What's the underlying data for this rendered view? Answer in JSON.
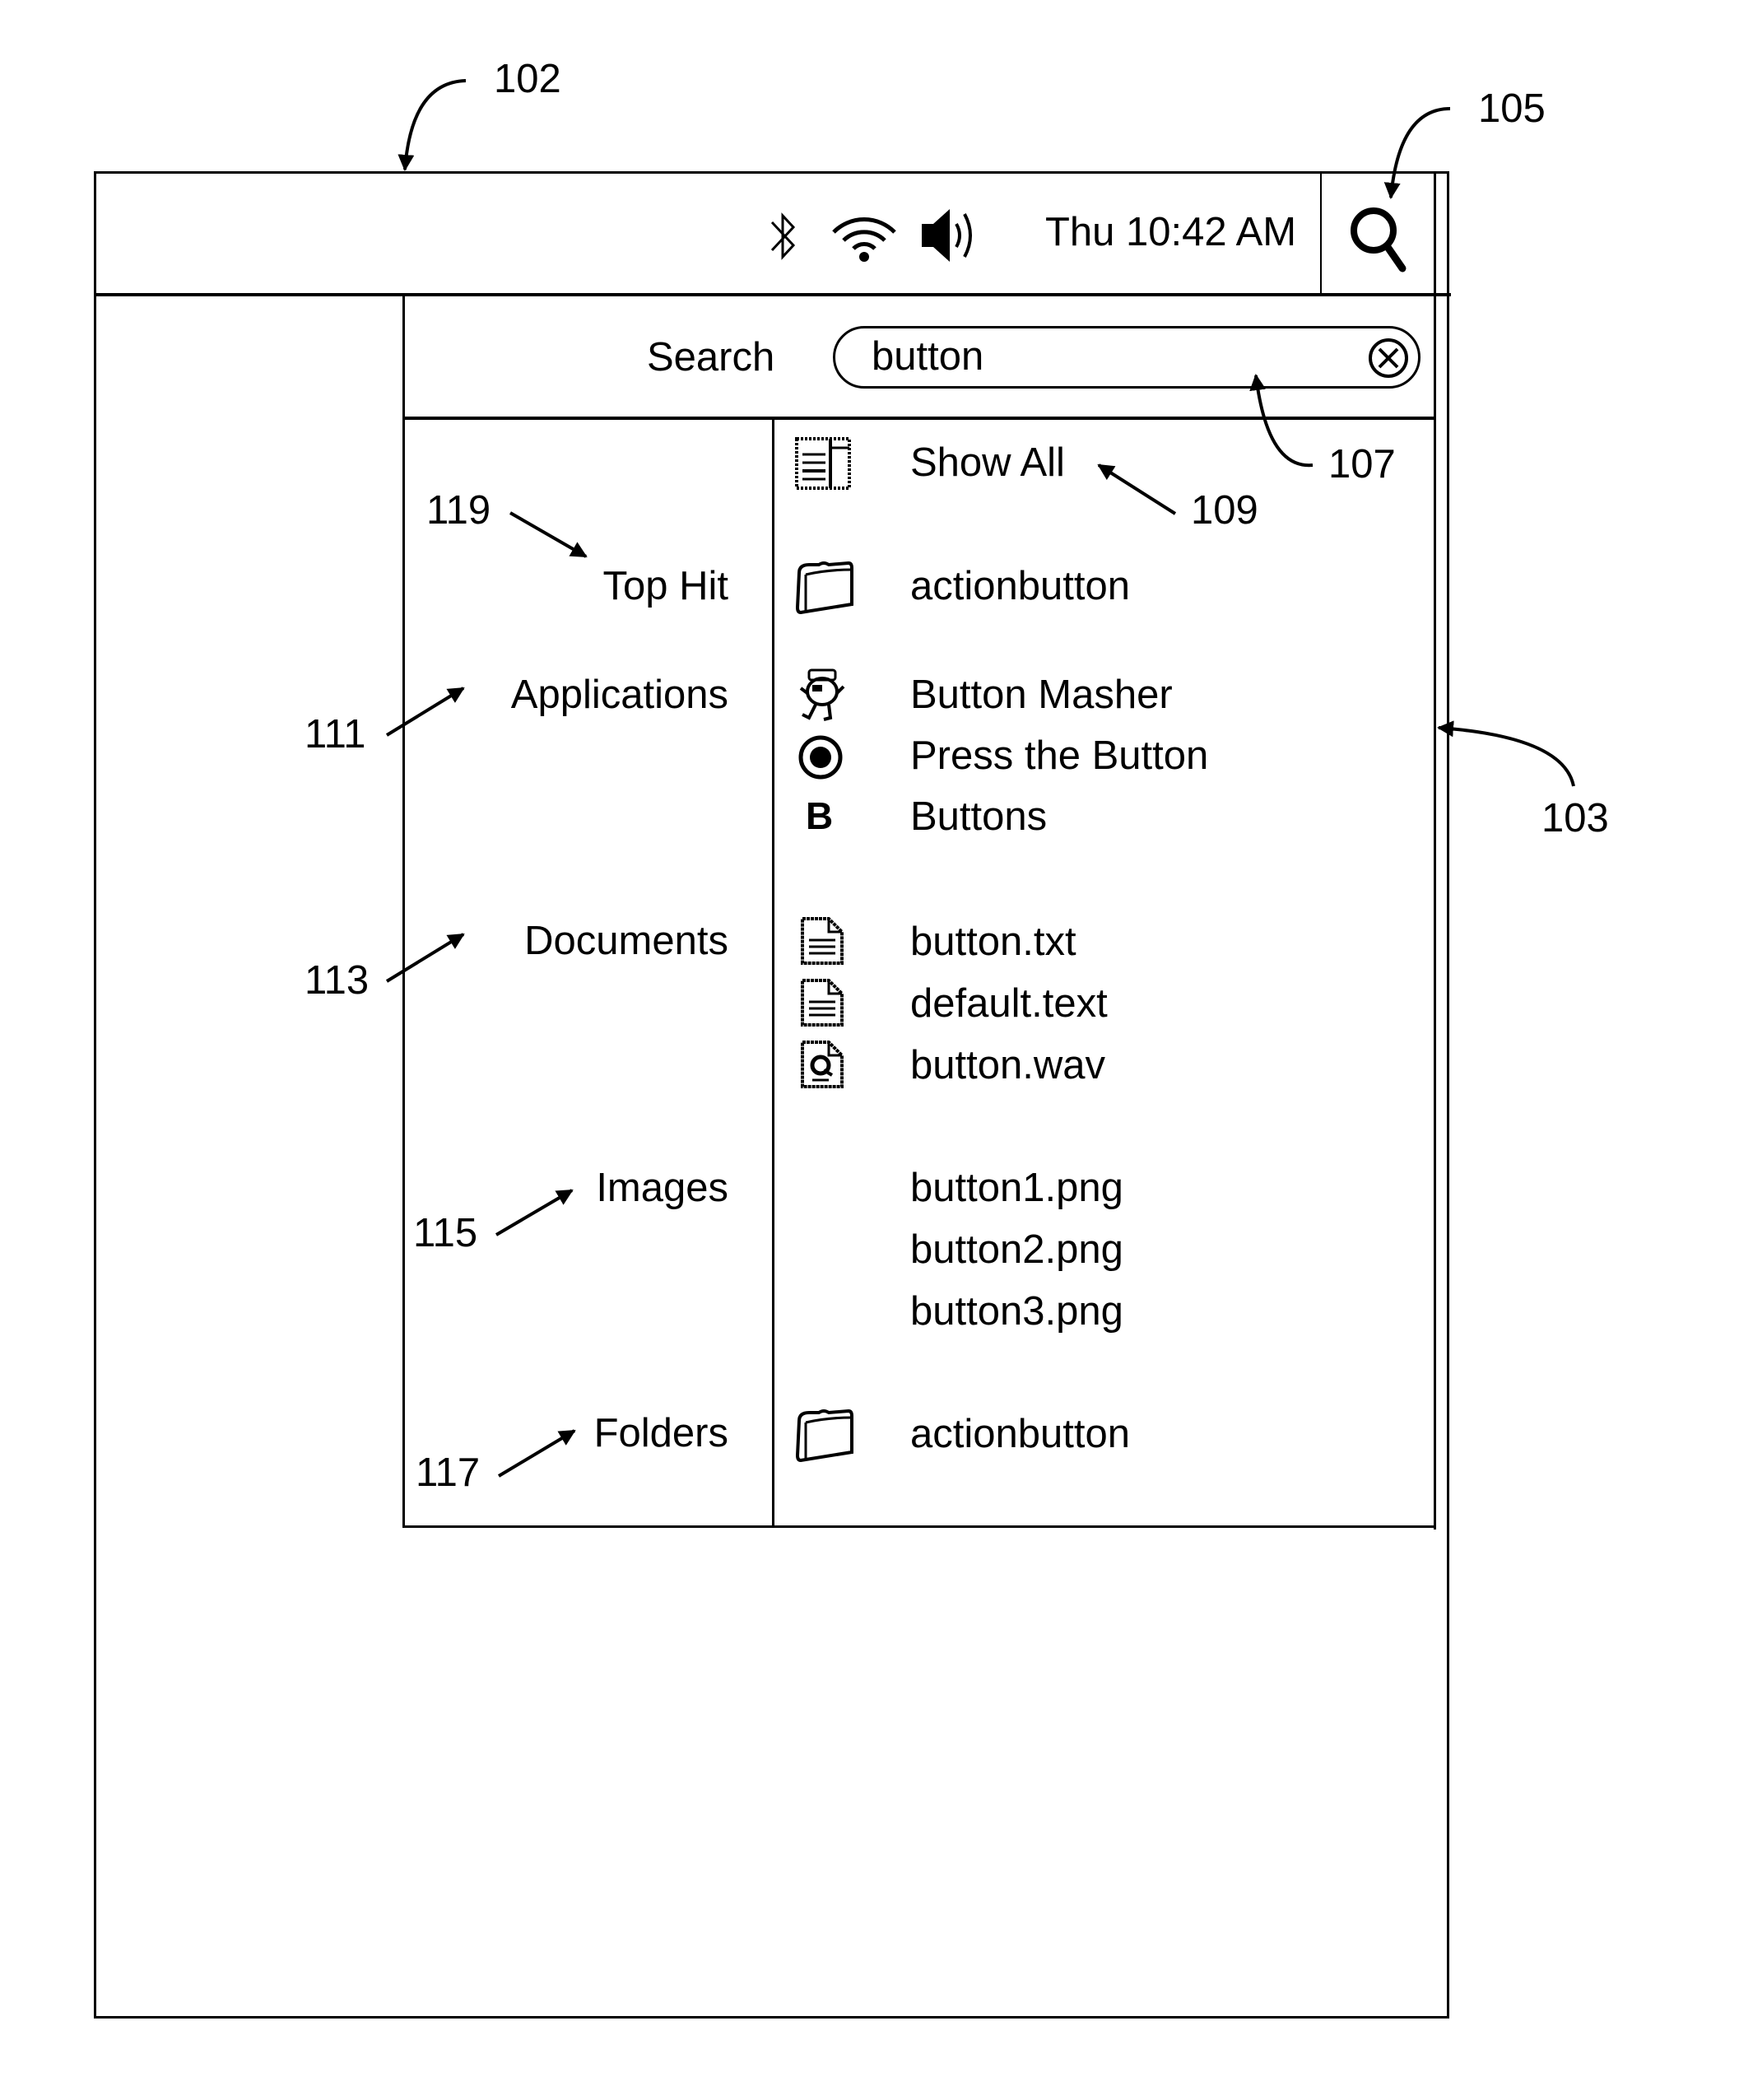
{
  "menubar": {
    "clock": "Thu 10:42 AM",
    "icons": [
      "bluetooth-icon",
      "wifi-icon",
      "volume-icon"
    ],
    "spotlight_icon": "magnifier-icon"
  },
  "search": {
    "label": "Search",
    "query": "button",
    "clear_icon": "clear-circle-x-icon"
  },
  "results": {
    "show_all": {
      "label": "Show All",
      "icon": "show-all-window-icon"
    },
    "categories": [
      {
        "name": "Top Hit",
        "items": [
          {
            "label": "actionbutton",
            "icon": "folder-icon"
          }
        ]
      },
      {
        "name": "Applications",
        "items": [
          {
            "label": "Button Masher",
            "icon": "character-app-icon"
          },
          {
            "label": "Press the Button",
            "icon": "radio-button-icon"
          },
          {
            "label": "Buttons",
            "icon": "letter-b-icon",
            "glyph": "B"
          }
        ]
      },
      {
        "name": "Documents",
        "items": [
          {
            "label": "button.txt",
            "icon": "text-document-icon"
          },
          {
            "label": "default.text",
            "icon": "text-document-icon"
          },
          {
            "label": "button.wav",
            "icon": "audio-document-icon"
          }
        ]
      },
      {
        "name": "Images",
        "items": [
          {
            "label": "button1.png"
          },
          {
            "label": "button2.png"
          },
          {
            "label": "button3.png"
          }
        ]
      },
      {
        "name": "Folders",
        "items": [
          {
            "label": "actionbutton",
            "icon": "folder-icon"
          }
        ]
      }
    ]
  },
  "reference_numerals": {
    "screen": "102",
    "panel": "103",
    "spotlight": "105",
    "search_field": "107",
    "show_all": "109",
    "applications": "111",
    "documents": "113",
    "images": "115",
    "folders": "117",
    "top_hit": "119"
  }
}
